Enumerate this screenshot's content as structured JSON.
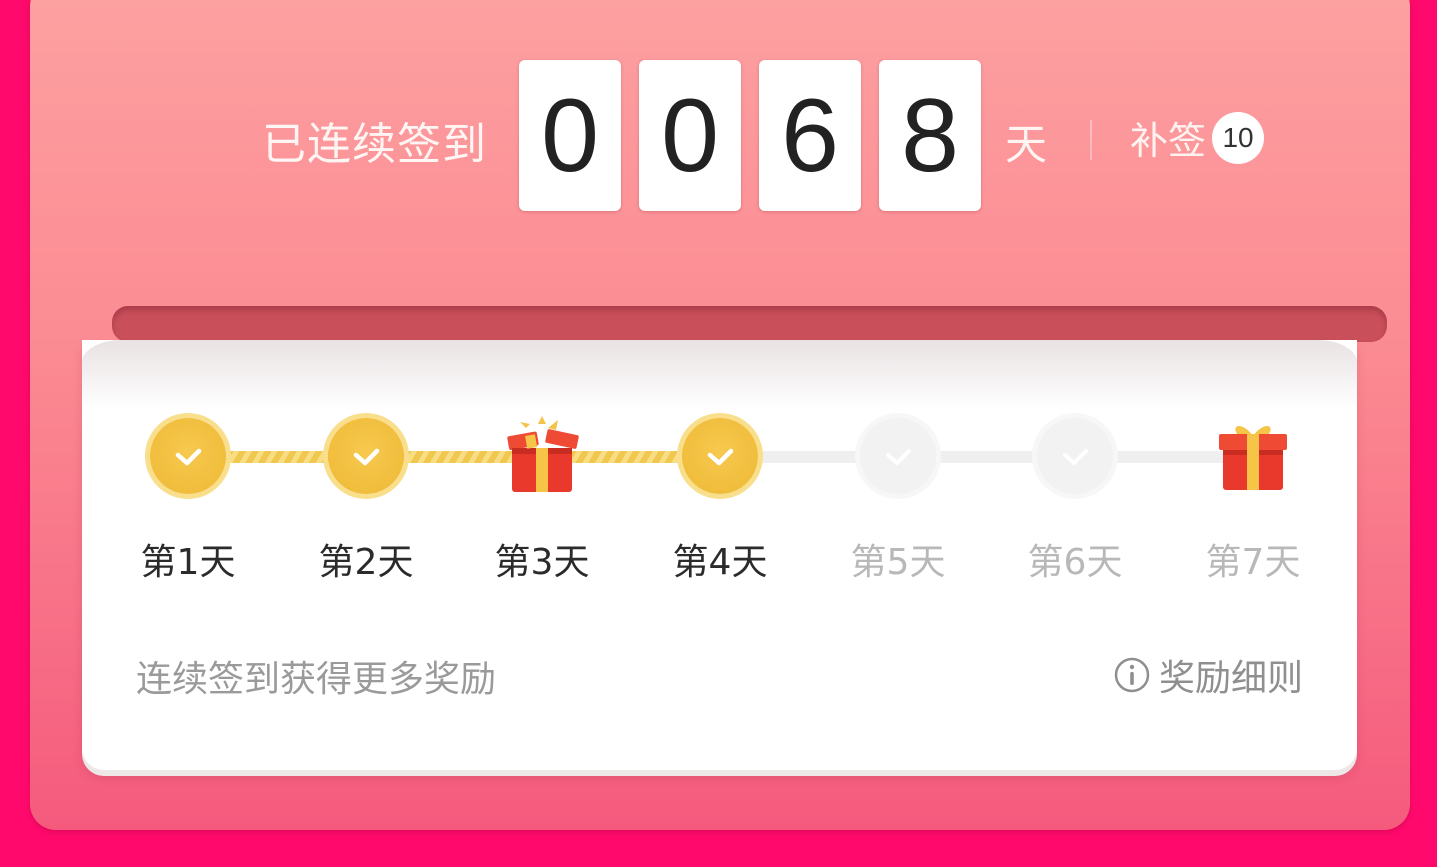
{
  "header": {
    "streak_label": "已连续签到",
    "digits": [
      "0",
      "0",
      "6",
      "8"
    ],
    "unit": "天",
    "makeup_label": "补签",
    "makeup_count": "10"
  },
  "days": [
    {
      "label": "第1天",
      "status": "checked",
      "icon": "check-icon"
    },
    {
      "label": "第2天",
      "status": "checked",
      "icon": "check-icon"
    },
    {
      "label": "第3天",
      "status": "gift-opened",
      "icon": "open-gift-icon"
    },
    {
      "label": "第4天",
      "status": "checked",
      "icon": "check-icon"
    },
    {
      "label": "第5天",
      "status": "pending",
      "icon": "check-icon"
    },
    {
      "label": "第6天",
      "status": "pending",
      "icon": "check-icon"
    },
    {
      "label": "第7天",
      "status": "gift",
      "icon": "gift-icon"
    }
  ],
  "footer": {
    "hint": "连续签到获得更多奖励",
    "rules_label": "奖励细则",
    "rules_icon": "info-icon"
  },
  "colors": {
    "page_bg": "#ff0a6c",
    "gold": "#f1bd3c",
    "gift_red": "#e8392c"
  }
}
